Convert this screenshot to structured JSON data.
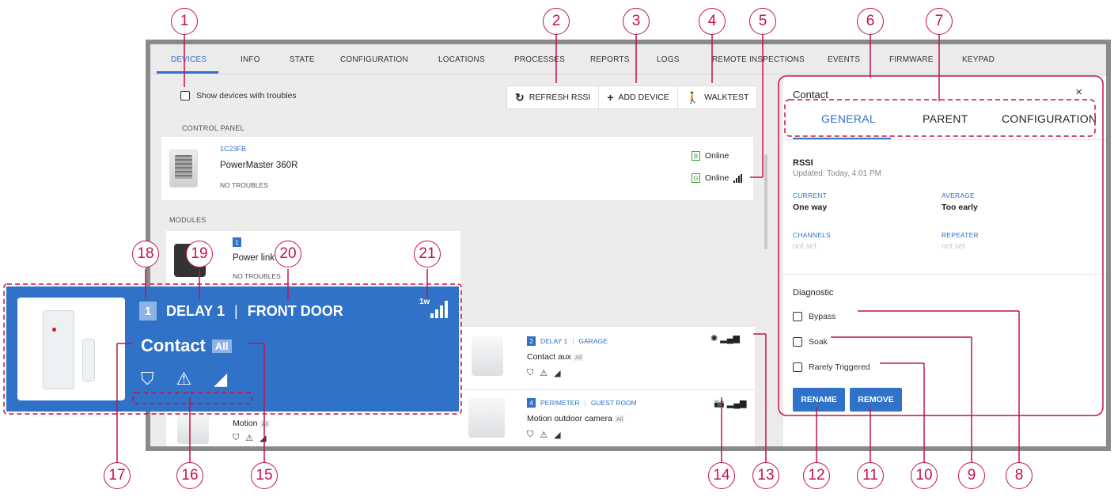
{
  "nav_tabs": [
    "DEVICES",
    "INFO",
    "STATE",
    "CONFIGURATION",
    "LOCATIONS",
    "PROCESSES",
    "REPORTS",
    "LOGS",
    "REMOTE INSPECTIONS",
    "EVENTS",
    "FIRMWARE",
    "KEYPAD"
  ],
  "active_tab": "DEVICES",
  "filter": {
    "label": "Show devices with troubles",
    "checked": false
  },
  "toolbar": {
    "refresh": "REFRESH RSSI",
    "add": "ADD DEVICE",
    "walktest": "WALKTEST"
  },
  "sections": {
    "control_panel": "CONTROL PANEL",
    "modules": "MODULES"
  },
  "control_panel": {
    "id": "1C23FB",
    "name": "PowerMaster 360R",
    "troubles": "NO TROUBLES",
    "status_b": {
      "letter": "B",
      "text": "Online"
    },
    "status_g": {
      "letter": "G",
      "text": "Online"
    }
  },
  "module": {
    "number": "1",
    "name": "Power link",
    "troubles": "NO TROUBLES"
  },
  "zones": [
    {
      "number": "2",
      "type": "DELAY 1",
      "location": "GARAGE",
      "name": "Contact aux",
      "tag": "All"
    },
    {
      "number": "4",
      "type": "PERIMETER",
      "location": "GUEST ROOM",
      "name": "Motion outdoor camera",
      "tag": "All"
    },
    {
      "name": "Motion",
      "tag": "All"
    }
  ],
  "zoom": {
    "number": "1",
    "type": "DELAY 1",
    "location": "FRONT DOOR",
    "name": "Contact",
    "tag": "All",
    "signal": "1w"
  },
  "side_panel": {
    "title": "Contact",
    "close": "×",
    "tabs": [
      "GENERAL",
      "PARENT",
      "CONFIGURATION"
    ],
    "active_tab": "GENERAL",
    "rssi": {
      "title": "RSSI",
      "updated": "Updated: Today, 4:01 PM"
    },
    "current": {
      "label": "CURRENT",
      "value": "One way"
    },
    "average": {
      "label": "AVERAGE",
      "value": "Too early"
    },
    "channels": {
      "label": "CHANNELS",
      "value": "not set"
    },
    "repeater": {
      "label": "REPEATER",
      "value": "not set"
    },
    "diagnostic": "Diagnostic",
    "checks": [
      "Bypass",
      "Soak",
      "Rarely Triggered"
    ],
    "rename": "RENAME",
    "remove": "REMOVE"
  },
  "callouts": [
    "1",
    "2",
    "3",
    "4",
    "5",
    "6",
    "7",
    "8",
    "9",
    "10",
    "11",
    "12",
    "13",
    "14",
    "15",
    "16",
    "17",
    "18",
    "19",
    "20",
    "21"
  ],
  "colors": {
    "accent": "#2f72c8",
    "callout": "#c4124a",
    "online": "#3aa53a"
  }
}
